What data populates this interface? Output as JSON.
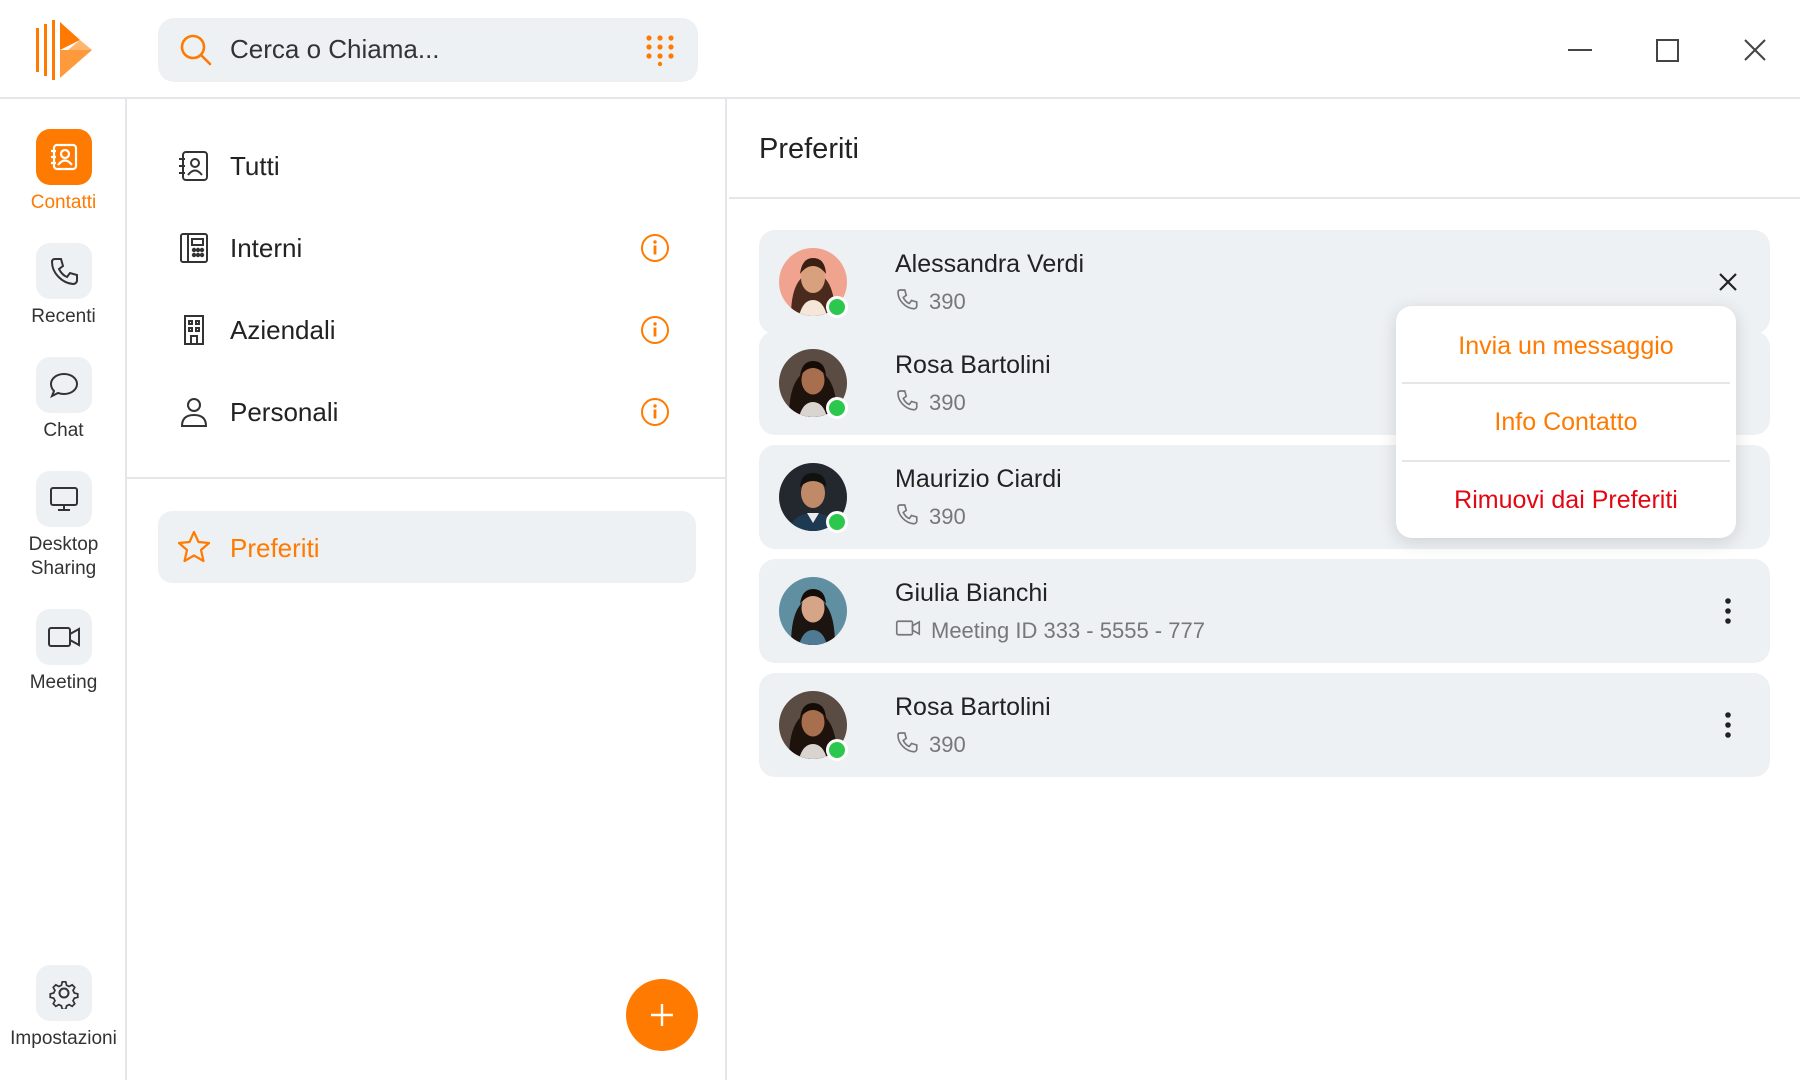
{
  "app": {
    "search_placeholder": "Cerca o Chiama...",
    "accent_color": "#ff7a00",
    "danger_color": "#e30613",
    "online_color": "#2cc84d"
  },
  "rail": {
    "items": [
      {
        "label": "Contatti",
        "icon": "contacts-icon",
        "active": true
      },
      {
        "label": "Recenti",
        "icon": "phone-icon"
      },
      {
        "label": "Chat",
        "icon": "chat-bubble-icon"
      },
      {
        "label": "Desktop Sharing",
        "icon": "monitor-icon"
      },
      {
        "label": "Meeting",
        "icon": "video-camera-icon"
      }
    ],
    "settings_label": "Impostazioni"
  },
  "categories": [
    {
      "label": "Tutti",
      "icon": "address-book-icon",
      "info": false
    },
    {
      "label": "Interni",
      "icon": "office-phone-icon",
      "info": true
    },
    {
      "label": "Aziendali",
      "icon": "building-icon",
      "info": true
    },
    {
      "label": "Personali",
      "icon": "person-icon",
      "info": true
    }
  ],
  "favorites_nav": {
    "label": "Preferiti",
    "icon": "star-icon"
  },
  "main": {
    "title": "Preferiti",
    "contacts": [
      {
        "name": "Alessandra Verdi",
        "sub_icon": "phone-icon",
        "sub": "390",
        "online": true,
        "action": "close-icon"
      },
      {
        "name": "Rosa Bartolini",
        "sub_icon": "phone-icon",
        "sub": "390",
        "online": true,
        "action": "more-icon"
      },
      {
        "name": "Maurizio Ciardi",
        "sub_icon": "phone-icon",
        "sub": "390",
        "online": true,
        "action": "more-icon"
      },
      {
        "name": "Giulia Bianchi",
        "sub_icon": "video-camera-icon",
        "sub": "Meeting ID 333 - 5555 - 777",
        "online": false,
        "action": "more-icon"
      },
      {
        "name": "Rosa Bartolini",
        "sub_icon": "phone-icon",
        "sub": "390",
        "online": true,
        "action": "more-icon"
      }
    ]
  },
  "context_menu": {
    "items": [
      {
        "label": "Invia un messaggio"
      },
      {
        "label": "Info Contatto"
      },
      {
        "label": "Rimuovi dai Preferiti"
      }
    ]
  }
}
